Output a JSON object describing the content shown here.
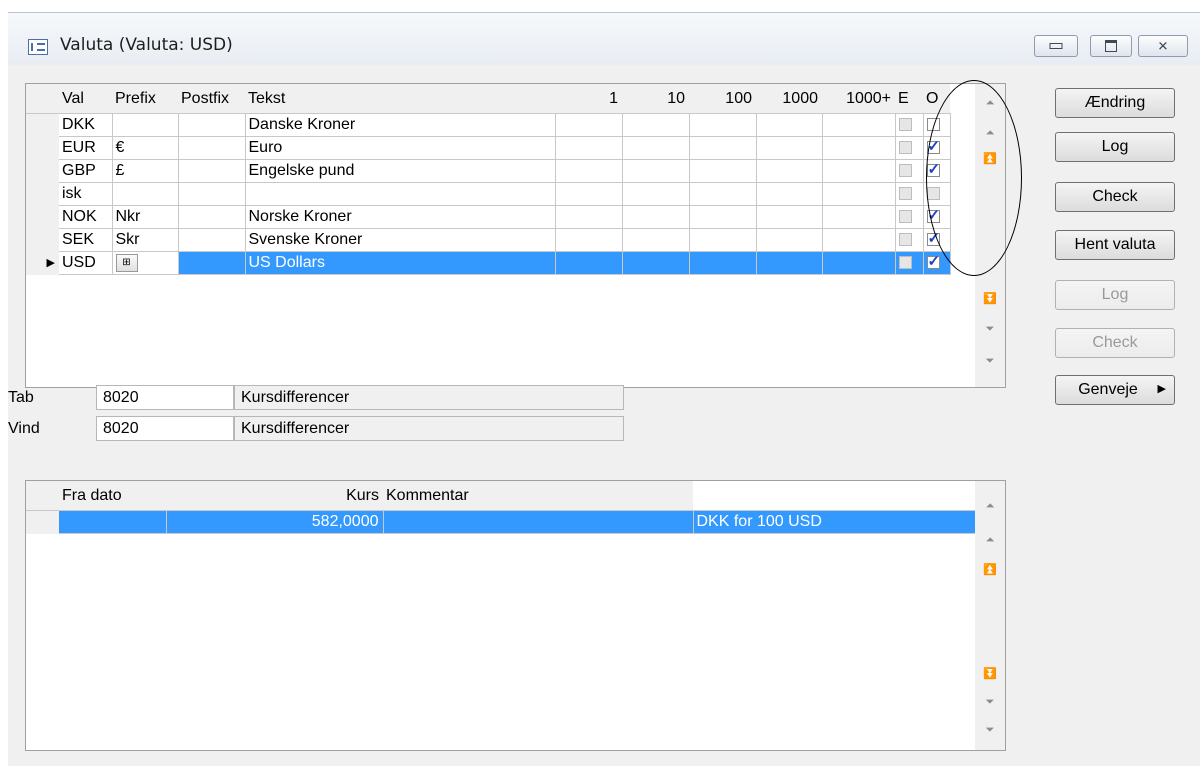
{
  "window": {
    "title": "Valuta (Valuta: USD)",
    "caption_buttons": [
      "minimize",
      "restore",
      "close"
    ]
  },
  "currency_grid": {
    "columns": [
      "Val",
      "Prefix",
      "Postfix",
      "Tekst",
      "1",
      "10",
      "100",
      "1000",
      "1000+",
      "E",
      "O"
    ],
    "rows": [
      {
        "val": "DKK",
        "prefix": "",
        "postfix": "",
        "tekst": "Danske Kroner",
        "e": false,
        "o": false,
        "e_grey": true
      },
      {
        "val": "EUR",
        "prefix": "€",
        "postfix": "",
        "tekst": "Euro",
        "e": false,
        "o": true,
        "e_grey": true
      },
      {
        "val": "GBP",
        "prefix": "£",
        "postfix": "",
        "tekst": "Engelske pund",
        "e": false,
        "o": true,
        "e_grey": true
      },
      {
        "val": "isk",
        "prefix": "",
        "postfix": "",
        "tekst": "",
        "e": false,
        "o": false,
        "e_grey": true
      },
      {
        "val": "NOK",
        "prefix": "Nkr",
        "postfix": "",
        "tekst": "Norske Kroner",
        "e": false,
        "o": true,
        "e_grey": true
      },
      {
        "val": "SEK",
        "prefix": "Skr",
        "postfix": "",
        "tekst": "Svenske Kroner",
        "e": false,
        "o": true,
        "e_grey": true
      },
      {
        "val": "USD",
        "prefix": "⊞",
        "postfix": "",
        "tekst": "US Dollars",
        "e": false,
        "o": true,
        "e_grey": true,
        "selected": true
      }
    ],
    "current_row_marker": "▶"
  },
  "accounts": {
    "tab": {
      "label": "Tab",
      "account": "8020",
      "name": "Kursdifferencer"
    },
    "vind": {
      "label": "Vind",
      "account": "8020",
      "name": "Kursdifferencer"
    }
  },
  "rate_grid": {
    "columns": [
      "Fra dato",
      "Kurs",
      "Kommentar"
    ],
    "rows": [
      {
        "fra_dato": "",
        "kurs": "582,0000",
        "kommentar": "",
        "note": "DKK for 100 USD",
        "selected": true
      }
    ]
  },
  "buttons": {
    "aendring": "Ændring",
    "log": "Log",
    "check": "Check",
    "hent_valuta": "Hent valuta",
    "log2": "Log",
    "check2": "Check",
    "genveje": "Genveje"
  },
  "scroll_icons": [
    "first-record-icon",
    "prev-page-icon",
    "prev-record-icon",
    "next-record-icon",
    "next-page-icon",
    "last-record-icon"
  ]
}
